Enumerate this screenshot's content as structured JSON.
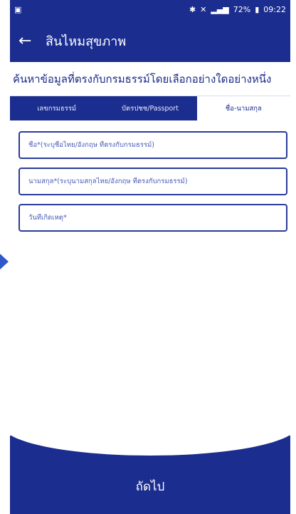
{
  "status": {
    "left_icon": "image-icon",
    "right_text": "72%",
    "time": "09:22"
  },
  "header": {
    "title": "สินไหมสุขภาพ"
  },
  "search": {
    "heading": "ค้นหาข้อมูลที่ตรงกับกรมธรรม์โดยเลือกอย่างใดอย่างหนึ่ง"
  },
  "tabs": [
    {
      "label": "เลขกรมธรรม์"
    },
    {
      "label": "บัตรปชช/Passport"
    },
    {
      "label": "ชื่อ-นามสกุล"
    }
  ],
  "fields": {
    "first_name": {
      "placeholder": "ชื่อ*(ระบุชื่อไทย/อังกฤษ ที่ตรงกับกรมธรรม์)"
    },
    "last_name": {
      "placeholder": "นามสกุล*(ระบุนามสกุลไทย/อังกฤษ ที่ตรงกับกรมธรรม์)"
    },
    "date": {
      "placeholder": "วันที่เกิดเหตุ*"
    }
  },
  "footer": {
    "next_label": "ถัดไป"
  },
  "colors": {
    "primary": "#1b2d8f",
    "accent": "#2f58c8",
    "background": "#ffffff"
  }
}
